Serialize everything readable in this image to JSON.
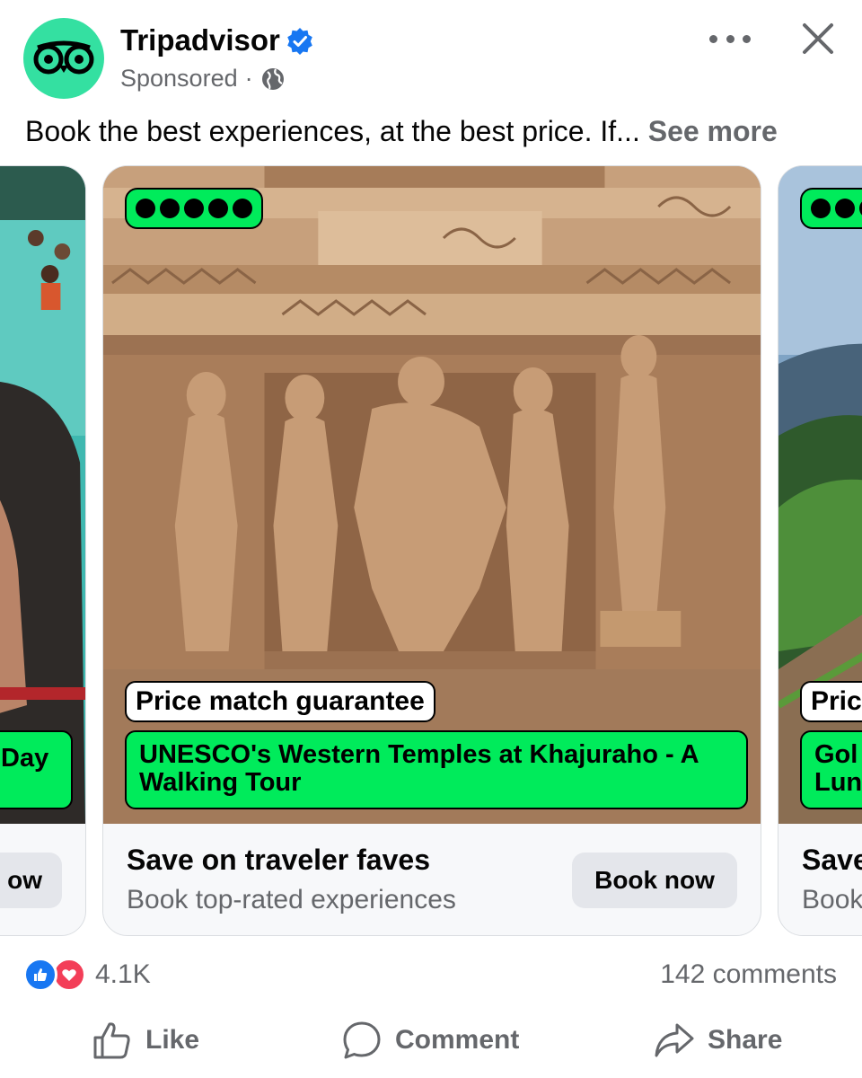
{
  "post": {
    "page_name": "Tripadvisor",
    "sponsored_label": "Sponsored",
    "separator": "·",
    "caption": "Book the best experiences, at the best price. If...",
    "see_more": "See more"
  },
  "carousel": {
    "left_card": {
      "title_fragment": "Day",
      "button_fragment": "ow"
    },
    "main_card": {
      "rating_bubbles": 5,
      "price_tag": "Price match guarantee",
      "title": "UNESCO's Western Temples at Khajuraho - A Walking Tour",
      "footer_title": "Save on traveler faves",
      "footer_subtitle": "Book top-rated experiences",
      "cta": "Book now"
    },
    "right_card": {
      "price_tag_fragment": "Pric",
      "title_fragment_1": "Gol",
      "title_fragment_2": "Lun",
      "footer_title_fragment": "Save",
      "footer_subtitle_fragment": "Book"
    }
  },
  "stats": {
    "reaction_count": "4.1K",
    "comments": "142 comments"
  },
  "actions": {
    "like": "Like",
    "comment": "Comment",
    "share": "Share"
  },
  "colors": {
    "brand_green": "#34e0a1",
    "tag_green": "#00eb5b",
    "facebook_blue": "#1877f2",
    "love_red": "#f33e58",
    "muted_text": "#65676b"
  },
  "icons": [
    "tripadvisor-owl-icon",
    "verified-badge-icon",
    "globe-icon",
    "more-icon",
    "close-icon",
    "like-reaction-icon",
    "love-reaction-icon",
    "thumbs-up-icon",
    "comment-bubble-icon",
    "share-arrow-icon"
  ]
}
